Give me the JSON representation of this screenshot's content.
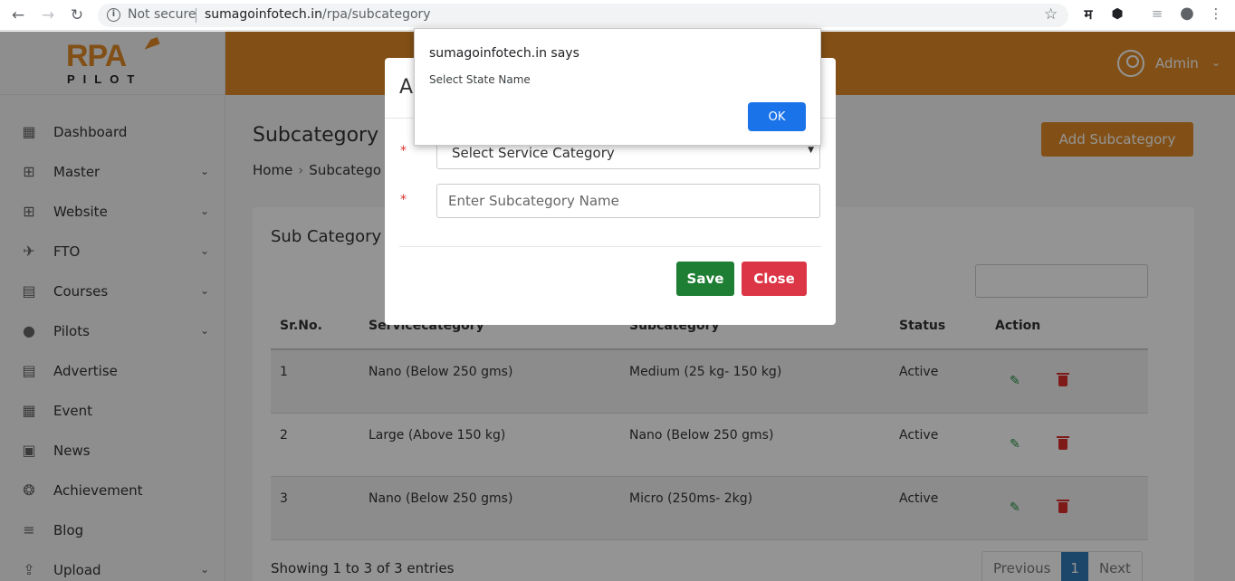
{
  "browser": {
    "security_label": "Not secure",
    "url_host": "sumagoinfotech.in",
    "url_path": "/rpa/subcategory",
    "ext_hindi": "म"
  },
  "logo": {
    "main": "RPA",
    "sub": "PILOT"
  },
  "header": {
    "user_label": "Admin"
  },
  "sidebar": {
    "items": [
      {
        "label": "Dashboard",
        "icon": "dashboard-grid-icon",
        "chevron": false
      },
      {
        "label": "Master",
        "icon": "table-icon",
        "chevron": true
      },
      {
        "label": "Website",
        "icon": "table-icon",
        "chevron": true
      },
      {
        "label": "FTO",
        "icon": "plane-icon",
        "chevron": true
      },
      {
        "label": "Courses",
        "icon": "book-icon",
        "chevron": true
      },
      {
        "label": "Pilots",
        "icon": "user-icon",
        "chevron": true
      },
      {
        "label": "Advertise",
        "icon": "newspaper-icon",
        "chevron": false
      },
      {
        "label": "Event",
        "icon": "calendar-icon",
        "chevron": false
      },
      {
        "label": "News",
        "icon": "id-card-icon",
        "chevron": false
      },
      {
        "label": "Achievement",
        "icon": "trophy-icon",
        "chevron": false
      },
      {
        "label": "Blog",
        "icon": "bars-icon",
        "chevron": false
      },
      {
        "label": "Upload",
        "icon": "upload-icon",
        "chevron": true
      }
    ]
  },
  "page": {
    "title": "Subcategory",
    "breadcrumb_home": "Home",
    "breadcrumb_current": "Subcatego",
    "add_button": "Add Subcategory"
  },
  "card": {
    "title": "Sub Category",
    "columns": [
      "Sr.No.",
      "Servicecategory",
      "Subcategory",
      "Status",
      "Action"
    ],
    "rows": [
      {
        "sr": "1",
        "service": "Nano (Below 250 gms)",
        "sub": "Medium (25 kg- 150 kg)",
        "status": "Active"
      },
      {
        "sr": "2",
        "service": "Large (Above 150 kg)",
        "sub": "Nano (Below 250 gms)",
        "status": "Active"
      },
      {
        "sr": "3",
        "service": "Nano (Below 250 gms)",
        "sub": "Micro (250ms- 2kg)",
        "status": "Active"
      }
    ],
    "info": "Showing 1 to 3 of 3 entries",
    "pager": {
      "previous": "Previous",
      "page": "1",
      "next": "Next"
    }
  },
  "modal": {
    "title": "A",
    "select_value": "Select Service Category",
    "name_placeholder": "Enter Subcategory Name",
    "required_mark": "*",
    "save": "Save",
    "close": "Close"
  },
  "alert": {
    "title": "sumagoinfotech.in says",
    "message": "Select State Name",
    "ok": "OK"
  },
  "colors": {
    "brand": "#e08a27",
    "save": "#1e7e34",
    "close": "#dc3545",
    "ok": "#1a73e8"
  }
}
